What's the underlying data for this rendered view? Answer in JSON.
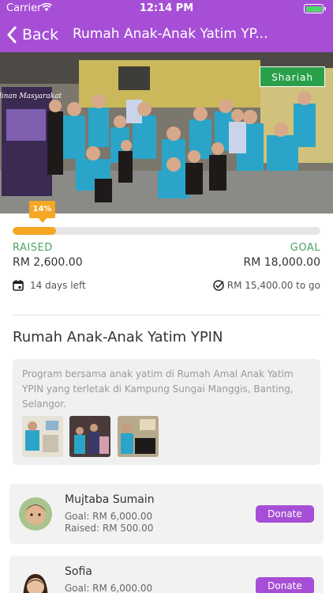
{
  "status_bar": {
    "carrier": "Carrier",
    "time": "12:14 PM"
  },
  "nav": {
    "back_label": "Back",
    "title": "Rumah Anak-Anak Yatim YP..."
  },
  "hero": {
    "badge": "Shariah",
    "banner_text": "Jalinan Masyarakat"
  },
  "campaign": {
    "progress_percent": 14,
    "progress_label": "14%",
    "raised_label": "RAISED",
    "goal_label": "GOAL",
    "raised_value": "RM 2,600.00",
    "goal_value": "RM 18,000.00",
    "days_left": "14 days left",
    "to_go": "RM 15,400.00 to go",
    "title": "Rumah Anak-Anak Yatim YPIN",
    "description": "Program bersama anak yatim di Rumah Amal Anak Yatim YPIN yang terletak di Kampung Sungai Manggis, Banting, Selangor."
  },
  "donors": [
    {
      "name": "Mujtaba Sumain",
      "goal": "Goal: RM 6,000.00",
      "raised": "Raised: RM 500.00",
      "button": "Donate"
    },
    {
      "name": "Sofia",
      "goal": "Goal: RM 6,000.00",
      "raised": "",
      "button": "Donate"
    }
  ],
  "colors": {
    "brand": "#a64fd6",
    "progress": "#f5a623",
    "accent_green": "#4aa364",
    "badge_green": "#2aa04a"
  },
  "icons": [
    "chevron-left-icon",
    "wifi-icon",
    "battery-icon",
    "calendar-icon",
    "check-circle-icon"
  ]
}
